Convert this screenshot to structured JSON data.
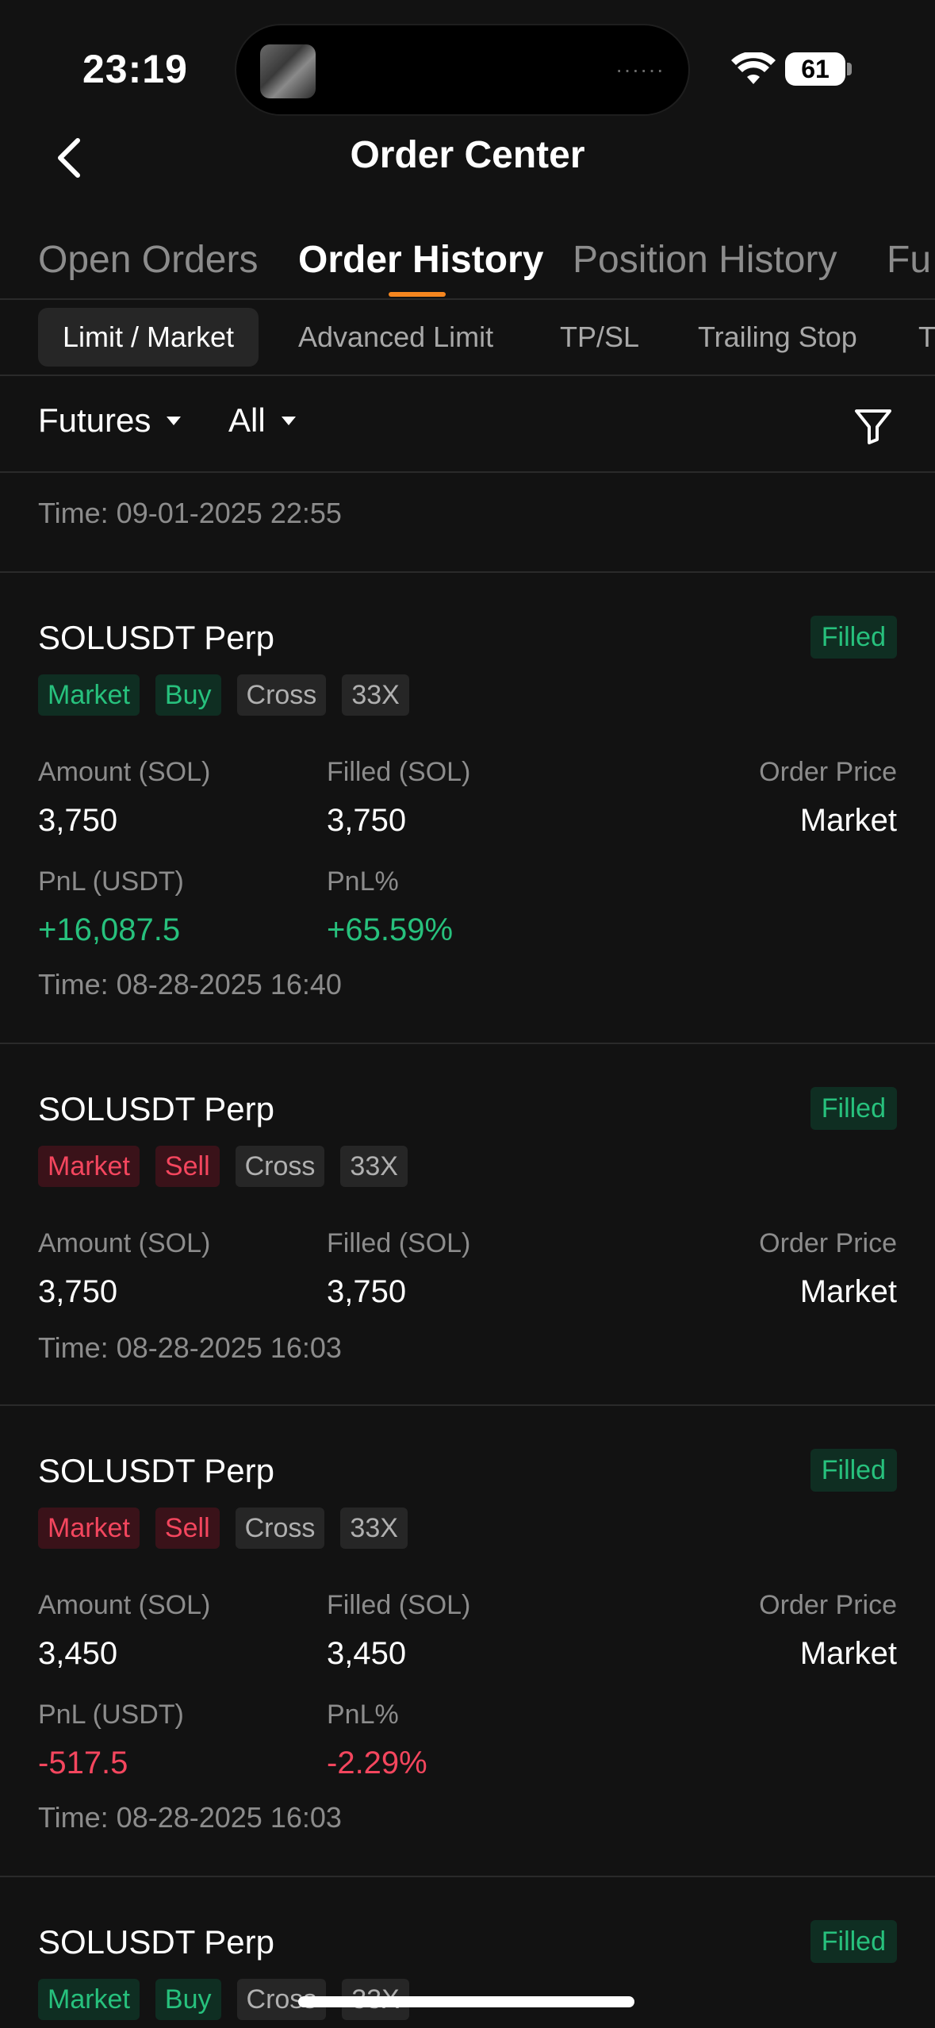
{
  "status_bar": {
    "time": "23:19",
    "battery": "61",
    "island_dots": "······"
  },
  "header": {
    "title": "Order Center"
  },
  "tabs": [
    {
      "label": "Open Orders"
    },
    {
      "label": "Order History"
    },
    {
      "label": "Position History"
    },
    {
      "label": "Fu"
    }
  ],
  "subtabs": [
    {
      "label": "Limit / Market"
    },
    {
      "label": "Advanced Limit"
    },
    {
      "label": "TP/SL"
    },
    {
      "label": "Trailing Stop"
    },
    {
      "label": "T"
    }
  ],
  "filters": {
    "market": "Futures",
    "side": "All"
  },
  "top_partial_time": "Time: 09-01-2025 22:55",
  "labels": {
    "amount": "Amount (SOL)",
    "filled": "Filled (SOL)",
    "order_price": "Order Price",
    "pnl": "PnL (USDT)",
    "pnl_pct": "PnL%"
  },
  "orders": [
    {
      "symbol": "SOLUSDT Perp",
      "status": "Filled",
      "tags": [
        "Market",
        "Buy",
        "Cross",
        "33X"
      ],
      "amount": "3,750",
      "filled": "3,750",
      "order_price": "Market",
      "pnl": "+16,087.5",
      "pnl_pct": "+65.59%",
      "time": "Time: 08-28-2025 16:40"
    },
    {
      "symbol": "SOLUSDT Perp",
      "status": "Filled",
      "tags": [
        "Market",
        "Sell",
        "Cross",
        "33X"
      ],
      "amount": "3,750",
      "filled": "3,750",
      "order_price": "Market",
      "time": "Time: 08-28-2025 16:03"
    },
    {
      "symbol": "SOLUSDT Perp",
      "status": "Filled",
      "tags": [
        "Market",
        "Sell",
        "Cross",
        "33X"
      ],
      "amount": "3,450",
      "filled": "3,450",
      "order_price": "Market",
      "pnl": "-517.5",
      "pnl_pct": "-2.29%",
      "time": "Time: 08-28-2025 16:03"
    },
    {
      "symbol": "SOLUSDT Perp",
      "status": "Filled",
      "tags": [
        "Market",
        "Buy",
        "Cross",
        "33X"
      ]
    }
  ],
  "colors": {
    "accent": "#f5861f",
    "positive": "#27c17d",
    "negative": "#f4465e",
    "background": "#121212"
  }
}
